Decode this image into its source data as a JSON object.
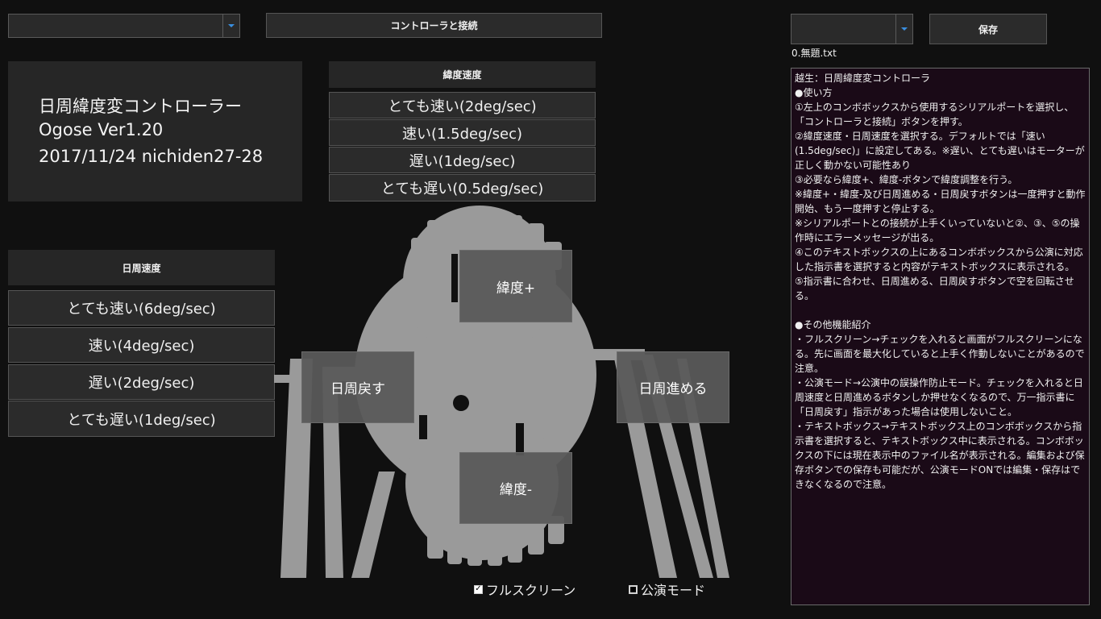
{
  "toolbar": {
    "port_combo_value": "",
    "connect_label": "コントローラと接続",
    "file_combo_value": "",
    "save_label": "保存",
    "current_file": "0.無題.txt"
  },
  "info": {
    "title": "日周緯度変コントローラー",
    "version": "Ogose Ver1.20",
    "date": "2017/11/24 nichiden27-28"
  },
  "latitude_speed": {
    "header": "緯度速度",
    "options": [
      "とても速い(2deg/sec)",
      "速い(1.5deg/sec)",
      "遅い(1deg/sec)",
      "とても遅い(0.5deg/sec)"
    ]
  },
  "diurnal_speed": {
    "header": "日周速度",
    "options": [
      "とても速い(6deg/sec)",
      "速い(4deg/sec)",
      "遅い(2deg/sec)",
      "とても遅い(1deg/sec)"
    ]
  },
  "controls": {
    "lat_plus": "緯度+",
    "lat_minus": "緯度-",
    "diurnal_back": "日周戻す",
    "diurnal_forward": "日周進める"
  },
  "options": {
    "fullscreen_label": "フルスクリーン",
    "fullscreen_checked": true,
    "performance_label": "公演モード",
    "performance_checked": false
  },
  "textbox": {
    "content": "越生：日周緯度変コントローラ\n●使い方\n①左上のコンボボックスから使用するシリアルポートを選択し、「コントローラと接続」ボタンを押す。\n②緯度速度・日周速度を選択する。デフォルトでは「速い(1.5deg/sec)」に設定してある。※遅い、とても遅いはモーターが正しく動かない可能性あり\n③必要なら緯度+、緯度-ボタンで緯度調整を行う。\n※緯度+・緯度-及び日周進める・日周戻すボタンは一度押すと動作開始、もう一度押すと停止する。\n※シリアルポートとの接続が上手くいっていないと②、③、⑤の操作時にエラーメッセージが出る。\n④このテキストボックスの上にあるコンボボックスから公演に対応した指示書を選択すると内容がテキストボックスに表示される。\n⑤指示書に合わせ、日周進める、日周戻すボタンで空を回転させる。\n\n●その他機能紹介\n・フルスクリーン→チェックを入れると画面がフルスクリーンになる。先に画面を最大化していると上手く作動しないことがあるので注意。\n・公演モード→公演中の誤操作防止モード。チェックを入れると日周速度と日周進めるボタンしか押せなくなるので、万一指示書に「日周戻す」指示があった場合は使用しないこと。\n・テキストボックス→テキストボックス上のコンボボックスから指示書を選択すると、テキストボックス中に表示される。コンボボックスの下には現在表示中のファイル名が表示される。編集および保存ボタンでの保存も可能だが、公演モードONでは編集・保存はできなくなるので注意。"
  },
  "colors": {
    "background": "#101010",
    "panel": "#262626",
    "button": "#2b2b2b",
    "textbox_bg": "#1a0a17",
    "combo_arrow": "#3a8fe0",
    "projector_gray": "#9a9a9a"
  }
}
